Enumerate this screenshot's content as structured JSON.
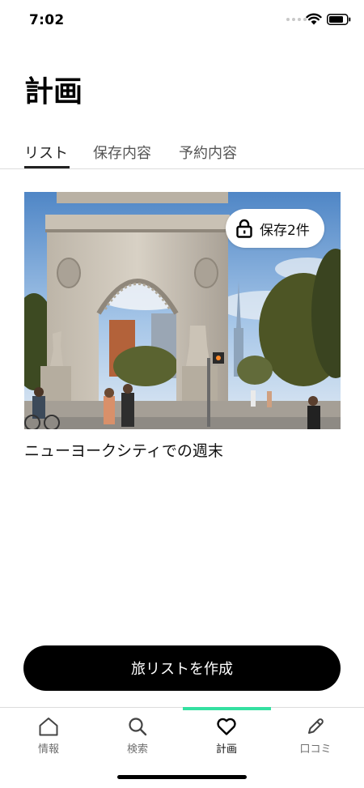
{
  "status_bar": {
    "time": "7:02"
  },
  "page": {
    "title": "計画"
  },
  "tabs": [
    {
      "label": "リスト",
      "active": true
    },
    {
      "label": "保存内容",
      "active": false
    },
    {
      "label": "予約内容",
      "active": false
    }
  ],
  "trip_card": {
    "title": "ニューヨークシティでの週末",
    "saved_label": "保存2件",
    "image_subject": "Washington Square Arch"
  },
  "create_button": {
    "label": "旅リストを作成"
  },
  "bottom_nav": {
    "items": [
      {
        "label": "情報",
        "icon": "home-icon"
      },
      {
        "label": "検索",
        "icon": "search-icon"
      },
      {
        "label": "計画",
        "icon": "heart-icon",
        "active": true
      },
      {
        "label": "口コミ",
        "icon": "pencil-icon"
      }
    ]
  },
  "colors": {
    "accent": "#34e0a1",
    "primary_button": "#000000"
  }
}
